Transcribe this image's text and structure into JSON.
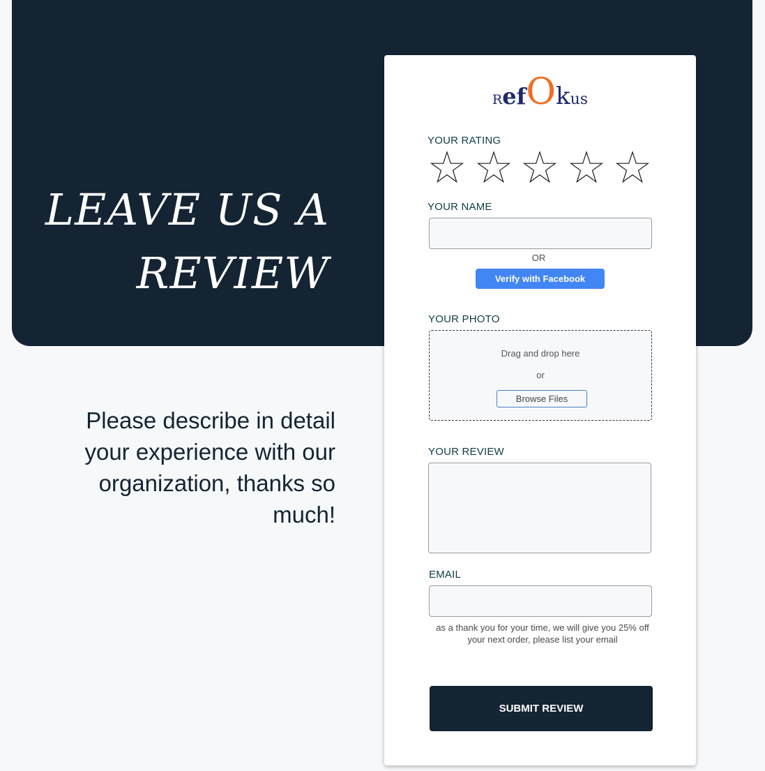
{
  "hero": {
    "title_line1": "LEAVE US A",
    "title_line2": "REVIEW",
    "description": "Please describe in detail your experience with our organization, thanks so much!"
  },
  "logo": {
    "part1": "R",
    "part2": "ef",
    "part3": "O",
    "part4": "k",
    "part5": "us"
  },
  "form": {
    "rating_label": "YOUR RATING",
    "rating": {
      "value": 0,
      "max": 5
    },
    "name_label": "YOUR NAME",
    "name_value": "",
    "or_text": "OR",
    "facebook_button": "Verify with Facebook",
    "photo_label": "YOUR PHOTO",
    "drop_text": "Drag and drop here",
    "drop_or": "or",
    "browse_button": "Browse Files",
    "review_label": "YOUR REVIEW",
    "review_value": "",
    "email_label": "EMAIL",
    "email_value": "",
    "email_hint": "as a thank you for your time, we will give you 25% off your next order, please list your email",
    "submit_button": "SUBMIT REVIEW"
  },
  "colors": {
    "hero_bg": "#142433",
    "accent_blue": "#4285f4",
    "logo_orange": "#f26c1f",
    "logo_navy": "#1f2a6b",
    "label_teal": "#0f3c45"
  },
  "icons": {
    "star": "star-outline-icon"
  }
}
